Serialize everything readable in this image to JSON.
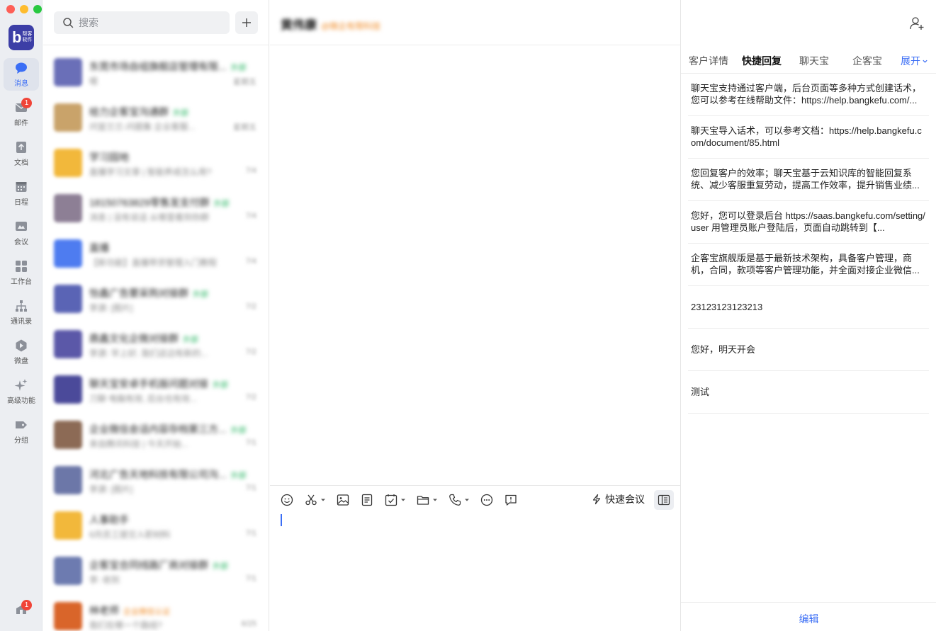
{
  "nav": {
    "items": [
      {
        "label": "消息",
        "icon": "chat-bubble-icon",
        "active": true
      },
      {
        "label": "邮件",
        "icon": "mail-icon",
        "badge": "1"
      },
      {
        "label": "文档",
        "icon": "document-icon"
      },
      {
        "label": "日程",
        "icon": "calendar-icon"
      },
      {
        "label": "会议",
        "icon": "meeting-icon"
      },
      {
        "label": "工作台",
        "icon": "workbench-grid-icon"
      },
      {
        "label": "通讯录",
        "icon": "org-chart-icon"
      },
      {
        "label": "微盘",
        "icon": "cloud-drive-icon"
      },
      {
        "label": "高级功能",
        "icon": "sparkle-icon"
      },
      {
        "label": "分组",
        "icon": "tag-icon"
      }
    ],
    "bottom_badge": "1"
  },
  "search": {
    "placeholder": "搜索"
  },
  "conversations": [
    {
      "name": "东莞市场自组旗舰店管理有限...",
      "tag": "外部",
      "preview": "嗯",
      "time": "星期五",
      "color": "#6a6fb8"
    },
    {
      "name": "给力企客宝沟通群",
      "tag": "外部",
      "preview": "问宣兰兰-问题集 企业客服...",
      "time": "星期五",
      "color": "#c9a36a"
    },
    {
      "name": "学习园地",
      "tag": "",
      "preview": "直播学习文章 | 智能养成怎么用?",
      "time": "7/4",
      "color": "#f2b83b"
    },
    {
      "name": "18150763829零售发支付群",
      "tag": "外部",
      "preview": "消息 | 没有说话 从哪里看到你群",
      "time": "7/4",
      "color": "#8d7f95"
    },
    {
      "name": "直播",
      "tag": "",
      "preview": "【新功能】直播带货管理入门教程",
      "time": "7/4",
      "color": "#4e7cf0"
    },
    {
      "name": "怡鑫广告要采购对接群",
      "tag": "外部",
      "preview": "李源: [图片]",
      "time": "7/2",
      "color": "#5a64b5"
    },
    {
      "name": "鼎鑫文化企微对接群",
      "tag": "外部",
      "preview": "李源: 早上好, 我们这边有新的...",
      "time": "7/2",
      "color": "#5b58a8"
    },
    {
      "name": "聊天宝安卓手机版问题对接",
      "tag": "外部",
      "preview": "刀聊 电脑有效, 后台也有效...",
      "time": "7/2",
      "color": "#4b4a9a"
    },
    {
      "name": "企业微信会话内容存档第三方...",
      "tag": "外部",
      "preview": "来自腾讯科技 | 今天开始...",
      "time": "7/1",
      "color": "#8c6a55"
    },
    {
      "name": "河北广告天地科技有限公司沟...",
      "tag": "外部",
      "preview": "李源: [图片]",
      "time": "7/1",
      "color": "#6c77a8"
    },
    {
      "name": "人事助手",
      "tag": "",
      "preview": "6月员工提交入职材料",
      "time": "7/1",
      "color": "#f2b83b"
    },
    {
      "name": "企客宝合同线路厂商对接群",
      "tag": "外部",
      "preview": "李: 收到",
      "time": "7/1",
      "color": "#6d7bb0"
    },
    {
      "name": "林老师",
      "tag": "企业微信认证",
      "tag_orange": true,
      "preview": "我们在哪一个路线?",
      "time": "6/25",
      "color": "#d9652a"
    }
  ],
  "chat": {
    "title": "黄伟康",
    "subtitle": "@微企有限科技",
    "toolbar": [
      {
        "icon": "emoji-icon",
        "caret": false
      },
      {
        "icon": "scissors-icon",
        "caret": true
      },
      {
        "icon": "image-icon",
        "caret": false
      },
      {
        "icon": "note-icon",
        "caret": false
      },
      {
        "icon": "task-check-icon",
        "caret": true
      },
      {
        "icon": "folder-icon",
        "caret": true
      },
      {
        "icon": "phone-icon",
        "caret": true
      },
      {
        "icon": "more-dots-icon",
        "caret": false
      },
      {
        "icon": "comment-icon",
        "caret": false
      }
    ],
    "quick_meeting_label": "快速会议"
  },
  "panel": {
    "tabs": [
      "客户详情",
      "快捷回复",
      "聊天宝",
      "企客宝"
    ],
    "active_tab": "快捷回复",
    "expand_label": "展开",
    "replies": [
      "聊天宝支持通过客户端，后台页面等多种方式创建话术，您可以参考在线帮助文件：https://help.bangkefu.com/...",
      "聊天宝导入话术，可以参考文档：https://help.bangkefu.com/document/85.html",
      "您回复客户的效率；聊天宝基于云知识库的智能回复系统、减少客服重复劳动，提高工作效率，提升销售业绩...",
      "您好，您可以登录后台 https://saas.bangkefu.com/setting/user 用管理员账户登陆后，页面自动跳转到【...",
      "企客宝旗舰版是基于最新技术架构，具备客户管理，商机，合同，款项等客户管理功能，并全面对接企业微信...",
      "23123123123213",
      "您好，明天开会",
      "测试"
    ],
    "edit_label": "编辑"
  }
}
